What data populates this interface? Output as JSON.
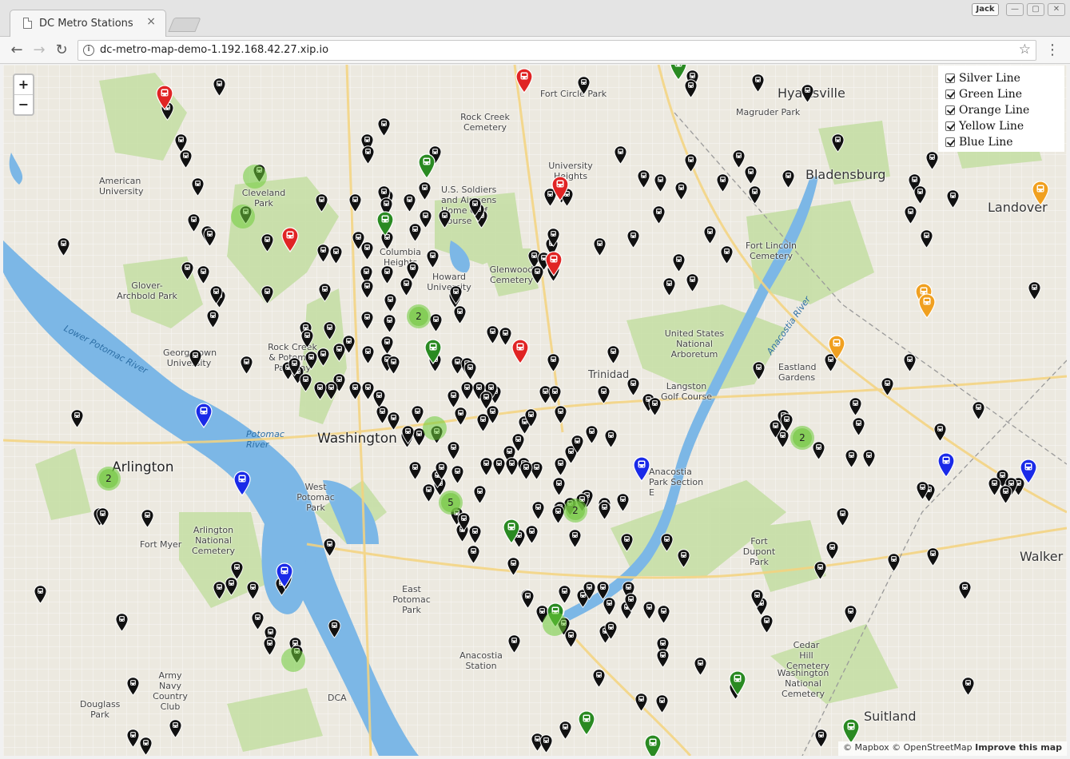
{
  "browser": {
    "tab_title": "DC Metro Stations",
    "tab_close": "×",
    "profile_name": "Jack",
    "url": "dc-metro-map-demo-1.192.168.42.27.xip.io",
    "back_icon": "arrow-left-icon",
    "forward_icon": "arrow-right-icon",
    "reload_icon": "reload-icon",
    "bookmark_icon": "star-icon",
    "menu_icon": "kebab-menu-icon"
  },
  "map": {
    "zoom_in": "+",
    "zoom_out": "−",
    "layers": [
      {
        "label": "Silver Line",
        "checked": true
      },
      {
        "label": "Green Line",
        "checked": true
      },
      {
        "label": "Orange Line",
        "checked": true
      },
      {
        "label": "Yellow Line",
        "checked": true
      },
      {
        "label": "Blue Line",
        "checked": true
      }
    ],
    "attribution": {
      "mapbox": "© Mapbox",
      "osm": "© OpenStreetMap",
      "improve": "Improve this map"
    },
    "places": {
      "washington": "Washington",
      "arlington": "Arlington",
      "hyattsville": "Hyattsville",
      "bladensburg": "Bladensburg",
      "landover": "Landover",
      "walker": "Walker",
      "suitland": "Suitland",
      "trinidad": "Trinidad",
      "eastland": "Eastland Gardens",
      "cleveland": "Cleveland Park",
      "glover": "Glover-Archbold Park",
      "georgetown": "Georgetown University",
      "rockcreek": "Rock Creek Cemetery",
      "soldiers": "U.S. Soldiers and Airmens Home Golf Course",
      "university": "University Heights",
      "howard": "Howard University",
      "glenwood": "Glenwood Cemetery",
      "arboretum": "United States National Arboretum",
      "langston": "Langston Golf Course",
      "fortlincoln": "Fort Lincoln Cemetery",
      "magruder": "Magruder Park",
      "fortcircle": "Fort Circle Park",
      "fortdupont": "Fort Dupont Park",
      "cedarhill": "Cedar Hill Cemetery",
      "washcemetery": "Washington National Cemetery",
      "anacostiapark": "Anacostia Park Section E",
      "anacostiastation": "Anacostia Station",
      "eastpotomac": "East Potomac Park",
      "westpotomac": "West Potomac Park",
      "arlcemetery": "Arlington National Cemetery",
      "fortmyer": "Fort Myer",
      "armynavy": "Army Navy Country Club",
      "douglass": "Douglass Park",
      "dca": "DCA",
      "americanu": "American University",
      "columbia": "Columbia Heights",
      "rockcreekpark": "Rock Creek & Potomac Parkway",
      "potomacriver": "Potomac River",
      "lowerpotomac": "Lower Potomac River",
      "anacostiariver": "Anacostia River"
    },
    "clusters": [
      "2",
      "2",
      "2",
      "5",
      "2"
    ],
    "line_colors": {
      "red": "#e02424",
      "green": "#2a8a22",
      "orange": "#f0a020",
      "blue": "#1a2ae8",
      "black": "#111111"
    }
  }
}
